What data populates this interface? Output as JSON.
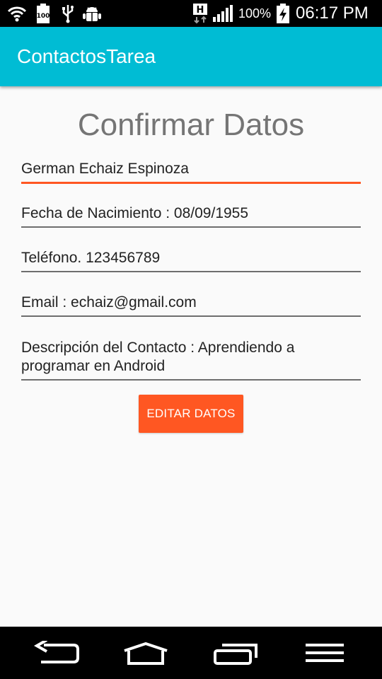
{
  "status_bar": {
    "icons_left": [
      "wifi-icon",
      "battery-100-indicator-icon",
      "usb-icon",
      "android-debug-icon"
    ],
    "network_type": "H",
    "battery_percent": "100%",
    "time": "06:17 PM"
  },
  "app_bar": {
    "title": "ContactosTarea"
  },
  "main": {
    "page_title": "Confirmar Datos",
    "fields": {
      "name": "German Echaiz Espinoza",
      "birthdate": "Fecha de Nacimiento : 08/09/1955",
      "phone": "Teléfono. 123456789",
      "email": "Email : echaiz@gmail.com",
      "description": "Descripción del Contacto : Aprendiendo a programar en Android"
    },
    "edit_button_label": "EDITAR DATOS"
  },
  "nav_bar": {
    "icons": [
      "back-icon",
      "home-icon",
      "recent-apps-icon",
      "menu-icon"
    ]
  },
  "colors": {
    "app_bar": "#00bcd4",
    "accent": "#ff5722",
    "status_bar": "#000000",
    "background": "#fafafa"
  }
}
